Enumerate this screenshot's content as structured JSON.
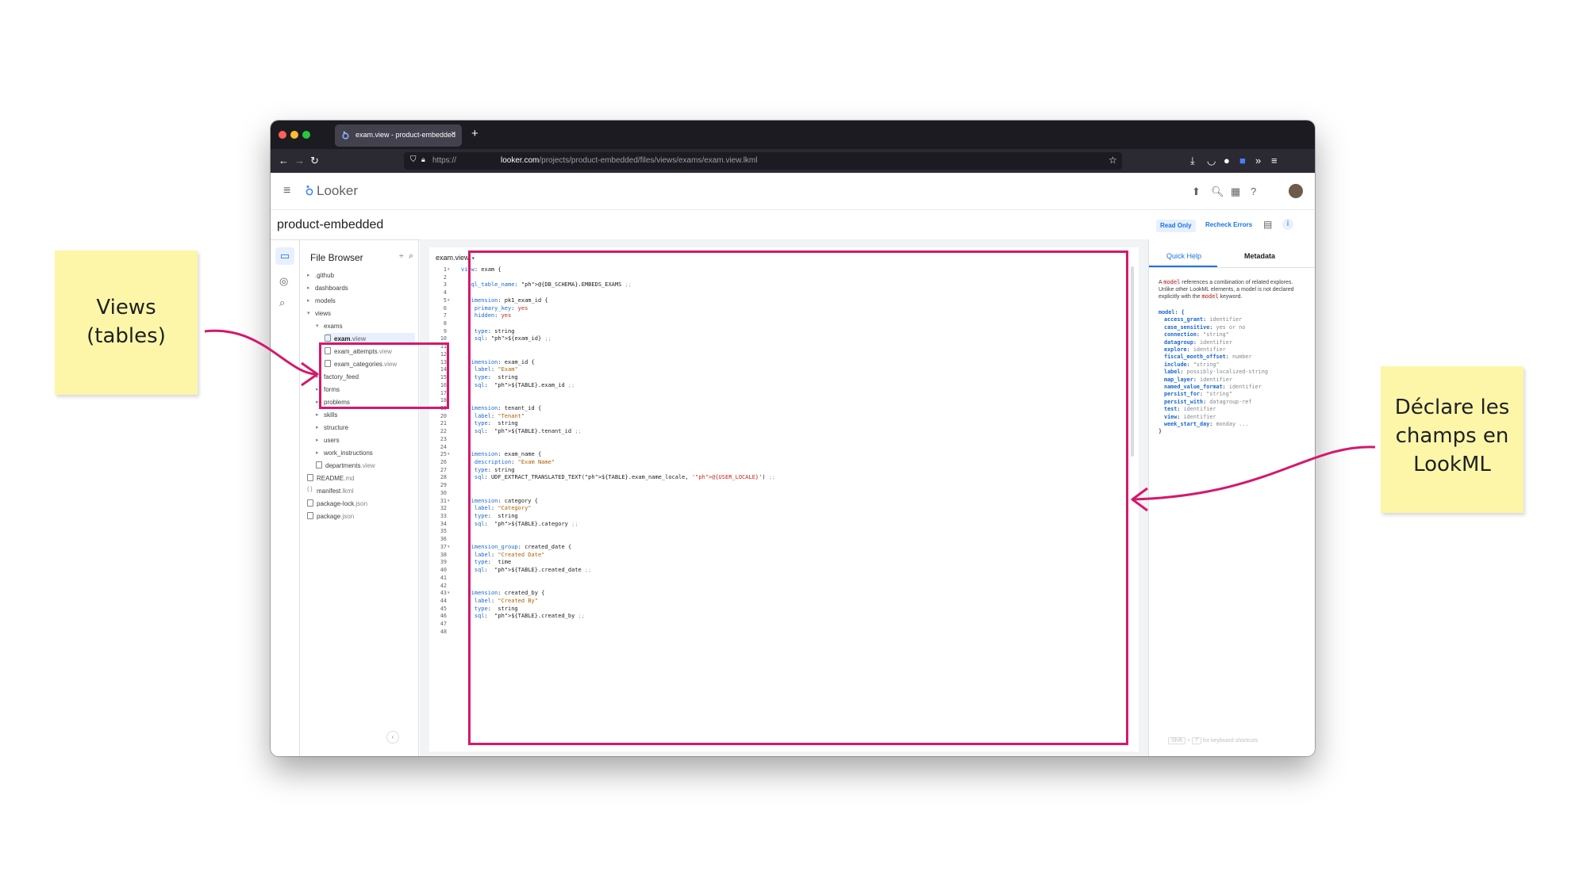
{
  "browser": {
    "tab_title": "exam.view - product-embedded",
    "tab_close": "×",
    "new_tab": "+",
    "url_proto": "https://",
    "url_host": "looker.com",
    "url_path": "/projects/product-embedded/files/views/exams/exam.view.lkml"
  },
  "looker": {
    "logo_text": "Looker",
    "project_name": "product-embedded",
    "read_only": "Read Only",
    "recheck_errors": "Recheck Errors"
  },
  "file_browser": {
    "title": "File Browser",
    "items": [
      {
        "name": ".github",
        "ext": "",
        "kind": "folder"
      },
      {
        "name": "dashboards",
        "ext": "",
        "kind": "folder"
      },
      {
        "name": "models",
        "ext": "",
        "kind": "folder"
      },
      {
        "name": "views",
        "ext": "",
        "kind": "folder-open"
      },
      {
        "name": "exams",
        "ext": "",
        "kind": "folder-open"
      },
      {
        "name": "exam",
        "ext": ".view",
        "kind": "view",
        "selected": true
      },
      {
        "name": "exam_attempts",
        "ext": ".view",
        "kind": "view"
      },
      {
        "name": "exam_categories",
        "ext": ".view",
        "kind": "view"
      },
      {
        "name": "factory_feed",
        "ext": "",
        "kind": "folder"
      },
      {
        "name": "forms",
        "ext": "",
        "kind": "folder"
      },
      {
        "name": "problems",
        "ext": "",
        "kind": "folder"
      },
      {
        "name": "skills",
        "ext": "",
        "kind": "folder"
      },
      {
        "name": "structure",
        "ext": "",
        "kind": "folder"
      },
      {
        "name": "users",
        "ext": "",
        "kind": "folder"
      },
      {
        "name": "work_instructions",
        "ext": "",
        "kind": "folder"
      },
      {
        "name": "departments",
        "ext": ".view",
        "kind": "view"
      },
      {
        "name": "README",
        "ext": ".md",
        "kind": "doc"
      },
      {
        "name": "manifest",
        "ext": ".lkml",
        "kind": "braces"
      },
      {
        "name": "package-lock",
        "ext": ".json",
        "kind": "doc"
      },
      {
        "name": "package",
        "ext": ".json",
        "kind": "doc"
      }
    ]
  },
  "editor": {
    "tab_label": "exam.view",
    "lines": [
      "view: exam {",
      "",
      "  sql_table_name: @{DB_SCHEMA}.EMBEDS_EXAMS ;;",
      "",
      "  dimension: pk1_exam_id {",
      "    primary_key: yes",
      "    hidden: yes",
      "",
      "    type: string",
      "    sql: ${exam_id} ;;",
      "  }",
      "",
      "  dimension: exam_id {",
      "    label: \"Exam\"",
      "    type:  string",
      "    sql:  ${TABLE}.exam_id ;;",
      "  }",
      "",
      "  dimension: tenant_id {",
      "    label: \"Tenant\"",
      "    type:  string",
      "    sql:  ${TABLE}.tenant_id ;;",
      "  }",
      "",
      "  dimension: exam_name {",
      "    description: \"Exam Name\"",
      "    type: string",
      "    sql: UDF_EXTRACT_TRANSLATED_TEXT(${TABLE}.exam_name_locale, '@{USER_LOCALE}') ;;",
      "  }",
      "",
      "  dimension: category {",
      "    label: \"Category\"",
      "    type:  string",
      "    sql:  ${TABLE}.category ;;",
      "  }",
      "",
      "  dimension_group: created_date {",
      "    label: \"Created Date\"",
      "    type:  time",
      "    sql:  ${TABLE}.created_date ;;",
      "  }",
      "",
      "  dimension: created_by {",
      "    label: \"Created By\"",
      "    type:  string",
      "    sql:  ${TABLE}.created_by ;;",
      "  }",
      ""
    ],
    "fold_lines": [
      1,
      5,
      13,
      19,
      25,
      31,
      37,
      43
    ]
  },
  "help": {
    "tab_quick_help": "Quick Help",
    "tab_metadata": "Metadata",
    "desc_pre": "A ",
    "desc_code1": "model",
    "desc_mid": " references a combination of related explores. Unlike other LookML elements, a model is not declared explicitly with the ",
    "desc_code2": "model",
    "desc_post": " keyword.",
    "model_open": "model: {",
    "params": [
      {
        "key": "access_grant",
        "val": "identifier"
      },
      {
        "key": "case_sensitive",
        "val": "yes or no"
      },
      {
        "key": "connection",
        "val": "\"string\""
      },
      {
        "key": "datagroup",
        "val": "identifier"
      },
      {
        "key": "explore",
        "val": "identifier"
      },
      {
        "key": "fiscal_month_offset",
        "val": "number"
      },
      {
        "key": "include",
        "val": "\"string\""
      },
      {
        "key": "label",
        "val": "possibly-localized-string"
      },
      {
        "key": "map_layer",
        "val": "identifier"
      },
      {
        "key": "named_value_format",
        "val": "identifier"
      },
      {
        "key": "persist_for",
        "val": "\"string\""
      },
      {
        "key": "persist_with",
        "val": "datagroup-ref"
      },
      {
        "key": "test",
        "val": "identifier"
      },
      {
        "key": "view",
        "val": "identifier"
      },
      {
        "key": "week_start_day",
        "val": "monday ..."
      }
    ],
    "model_close": "}",
    "shortcut_key1": "Shift",
    "shortcut_plus": "+",
    "shortcut_key2": "?",
    "shortcut_text": "for keyboard shortcuts"
  },
  "annotations": {
    "views_note": [
      "Views",
      "(tables)"
    ],
    "declare_note": [
      "Déclare les",
      "champs en",
      "LookML"
    ],
    "accent_color": "#d6186b",
    "sticky_color": "#fdf6a9"
  }
}
